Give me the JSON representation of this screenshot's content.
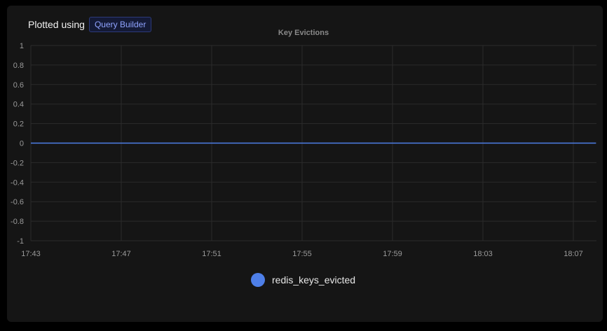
{
  "header": {
    "plotted_label": "Plotted using",
    "builder_badge": "Query Builder"
  },
  "chart_data": {
    "type": "line",
    "title": "Key Evictions",
    "xlabel": "",
    "ylabel": "",
    "x_ticks": [
      "17:43",
      "17:47",
      "17:51",
      "17:55",
      "17:59",
      "18:03",
      "18:07"
    ],
    "y_ticks": [
      "1",
      "0.8",
      "0.6",
      "0.4",
      "0.2",
      "0",
      "-0.2",
      "-0.4",
      "-0.6",
      "-0.8",
      "-1"
    ],
    "ylim": [
      -1,
      1
    ],
    "grid": true,
    "legend_position": "bottom",
    "series": [
      {
        "name": "redis_keys_evicted",
        "color": "#4e7fe8",
        "x": [
          "17:43",
          "18:08"
        ],
        "values": [
          0,
          0
        ]
      }
    ]
  },
  "legend": {
    "items": [
      {
        "label": "redis_keys_evicted",
        "color": "#4e7fe8"
      }
    ]
  }
}
